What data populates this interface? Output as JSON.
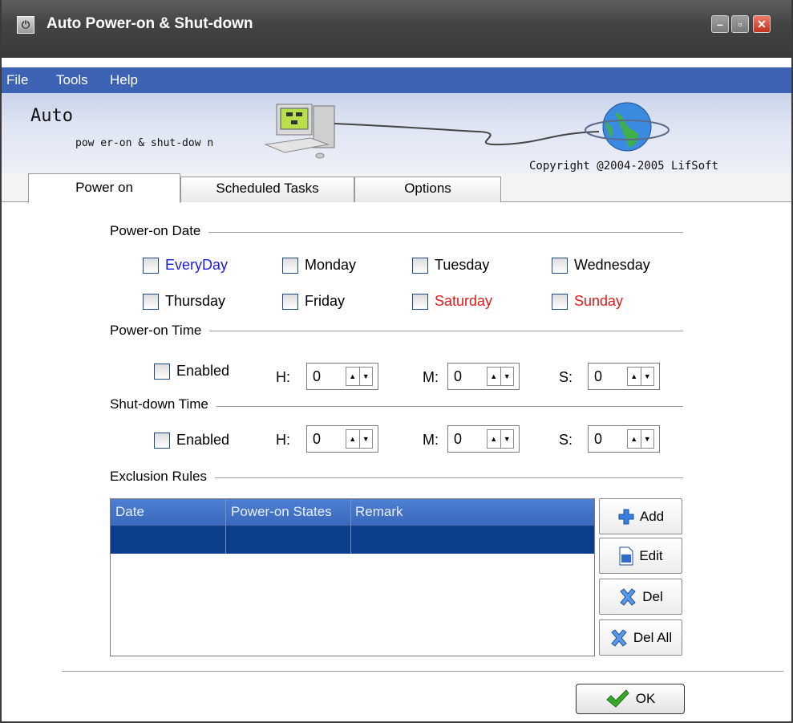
{
  "window": {
    "title": "Auto Power-on & Shut-down"
  },
  "menu": {
    "file": "File",
    "tools": "Tools",
    "help": "Help"
  },
  "banner": {
    "title": "Auto",
    "subtitle": "pow er-on & shut-dow n",
    "copyright": "Copyright @2004-2005 LifSoft"
  },
  "tabs": [
    {
      "label": "Power on",
      "active": true
    },
    {
      "label": "Scheduled Tasks",
      "active": false
    },
    {
      "label": "Options",
      "active": false
    }
  ],
  "power_on_date": {
    "label": "Power-on Date",
    "days": [
      "EveryDay",
      "Monday",
      "Tuesday",
      "Wednesday",
      "Thursday",
      "Friday",
      "Saturday",
      "Sunday"
    ]
  },
  "power_on_time": {
    "label": "Power-on Time",
    "enabled_label": "Enabled",
    "h_label": "H:",
    "m_label": "M:",
    "s_label": "S:",
    "h": "0",
    "m": "0",
    "s": "0"
  },
  "shutdown_time": {
    "label": "Shut-down Time",
    "enabled_label": "Enabled",
    "h_label": "H:",
    "m_label": "M:",
    "s_label": "S:",
    "h": "0",
    "m": "0",
    "s": "0"
  },
  "exclusion": {
    "label": "Exclusion Rules",
    "columns": [
      "Date",
      "Power-on States",
      "Remark"
    ],
    "buttons": {
      "add": "Add",
      "edit": "Edit",
      "del": "Del",
      "del_all": "Del All"
    }
  },
  "ok_label": "OK",
  "colors": {
    "menubar": "#3d63b5",
    "list_header": "#4676cc",
    "selected_row": "#0d3e8c",
    "weekday_blue": "#1b1be0",
    "weekend_red": "#e31a1a"
  }
}
